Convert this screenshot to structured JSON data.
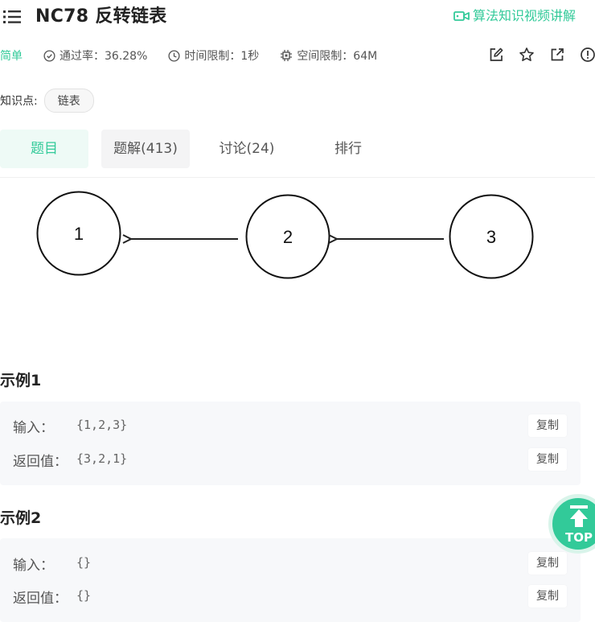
{
  "header": {
    "title": "NC78  反转链表",
    "video_link": "算法知识视频讲解"
  },
  "meta": {
    "difficulty": "简单",
    "pass_rate": "通过率：36.28%",
    "time_limit": "时间限制：1秒",
    "space_limit": "空间限制：64M"
  },
  "knowledge": {
    "label": "知识点:",
    "tags": [
      "链表"
    ]
  },
  "tabs": [
    {
      "label": "题目"
    },
    {
      "label": "题解(413)"
    },
    {
      "label": "讨论(24)"
    },
    {
      "label": "排行"
    }
  ],
  "diagram": {
    "nodes": [
      "1",
      "2",
      "3"
    ]
  },
  "examples": [
    {
      "title": "示例1",
      "input_label": "输入：",
      "input_value": "{1,2,3}",
      "output_label": "返回值：",
      "output_value": "{3,2,1}",
      "copy_label": "复制"
    },
    {
      "title": "示例2",
      "input_label": "输入：",
      "input_value": "{}",
      "output_label": "返回值：",
      "output_value": "{}",
      "copy_label": "复制"
    }
  ],
  "top_button": {
    "label": "TOP"
  },
  "colors": {
    "accent": "#32ca99",
    "tab_active_bg": "#eefaf6",
    "example_bg": "#f7f8fa"
  }
}
